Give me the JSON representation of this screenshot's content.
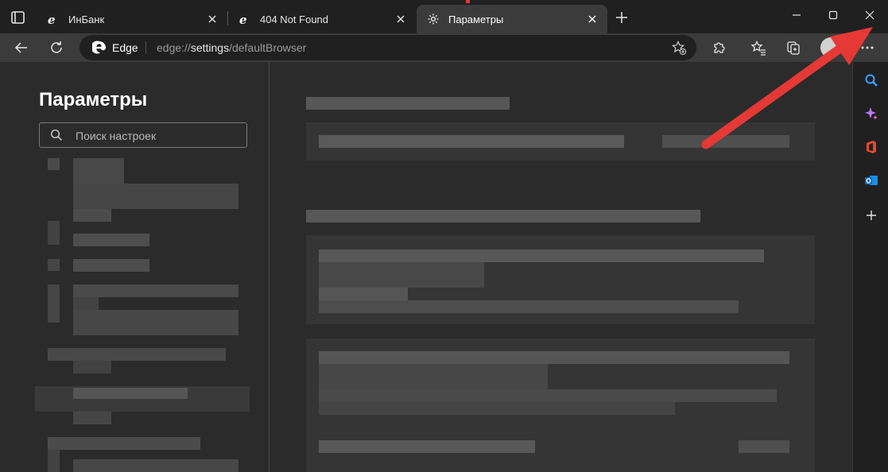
{
  "tabs": [
    {
      "title": "ИнБанк",
      "icon": "ie-icon",
      "active": false
    },
    {
      "title": "404 Not Found",
      "icon": "ie-icon",
      "active": false
    },
    {
      "title": "Параметры",
      "icon": "gear-icon",
      "active": true
    }
  ],
  "address_bar": {
    "brand": "Edge",
    "url_prefix": "edge://",
    "url_host": "settings",
    "url_path": "/defaultBrowser"
  },
  "settings": {
    "title": "Параметры",
    "search_placeholder": "Поиск настроек"
  },
  "colors": {
    "annotation_arrow": "#e53935",
    "tab_active": "#3b3b3b",
    "background": "#202020"
  }
}
